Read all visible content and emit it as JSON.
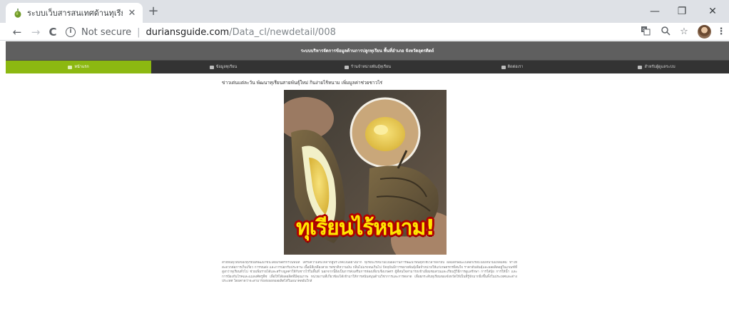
{
  "browser": {
    "tab_title": "ระบบเว็บสารสนเทศด้านทุเรียน",
    "tab_close": "✕",
    "new_tab": "+",
    "window": {
      "minimize": "—",
      "restore": "❐",
      "close": "✕"
    },
    "nav": {
      "back": "←",
      "forward": "→",
      "reload": "C"
    },
    "security_label": "Not secure",
    "url_host": "duriansguide.com",
    "url_path": "/Data_cl/newdetail/008"
  },
  "site": {
    "banner": "ระบบบริหารจัดการข้อมูลด้านการปลูกทุเรียน พื้นที่อำเภอ จังหวัดอุตรดิตถ์",
    "menu": [
      {
        "label": "หน้าแรก",
        "active": true
      },
      {
        "label": "ข้อมูลทุเรียน",
        "active": false
      },
      {
        "label": "ร้านจำหน่ายพันธุ์ทุเรียน",
        "active": false
      },
      {
        "label": "ติดต่อเรา",
        "active": false
      },
      {
        "label": "สำหรับผู้ดูแลระบบ",
        "active": false
      }
    ]
  },
  "article": {
    "title": "ข่าวเด่นแต่ละวัน พัฒนาทุเรียนสายพันธุ์ใหม่ กินง่ายไร้หนาม เพิ่มมูลค่าช่วยชาวไร่",
    "image_caption": "ทุเรียนไร้หนาม!",
    "body": "สายพันธุ์ใหม่ของทุเรียนที่พัฒนาขึ้นโดยเกษตรกรในพื้นที่ ได้รับความสนใจจากผู้บริโภคเป็นอย่างมาก ทุเรียนไร้หนามเป็นผลงานการพัฒนาพันธุ์ที่ใช้เวลาหลายปี ผลมีลักษณะเปลือกเรียบไม่มีหนามแหลมคม ทำให้สะดวกต่อการเก็บเกี่ยว การขนส่ง และการปอกรับประทาน เนื้อมีสีเหลืองสวย รสชาติหวานมัน กลิ่นไม่แรงจนเกินไป ปัจจุบันมีการขยายพันธุ์เพื่อจำหน่ายให้แก่เกษตรกรที่สนใจ ราคาต้นพันธุ์และผลผลิตอยู่ในเกณฑ์ที่สูงกว่าทุเรียนทั่วไป ช่วยเพิ่มรายได้และสร้างมูลค่าให้กับชาวไร่ในพื้นที่ นอกจากนี้ยังเป็นการส่งเสริมการท่องเที่ยวเชิงเกษตร ผู้ที่สนใจสามารถเข้าเยี่ยมชมสวนและเรียนรู้วิธีการดูแลรักษา การใส่ปุ๋ย การให้น้ำ และการป้องกันโรคและแมลงศัตรูพืช เพื่อให้ได้ผลผลิตที่มีคุณภาพ หน่วยงานที่เกี่ยวข้องได้เข้ามาให้การสนับสนุนด้านวิชาการและการตลาด เพื่อยกระดับทุเรียนของจังหวัดให้เป็นที่รู้จักมากยิ่งขึ้นทั้งในประเทศและต่างประเทศ โดยคาดว่าจะสามารถส่งออกผลผลิตได้ในอนาคตอันใกล้"
  },
  "colors": {
    "menu_active": "#8cb811",
    "menu_bar": "#333333",
    "banner": "#5f5f5f",
    "caption_fill": "#ffe600",
    "caption_outline": "#b00000"
  }
}
